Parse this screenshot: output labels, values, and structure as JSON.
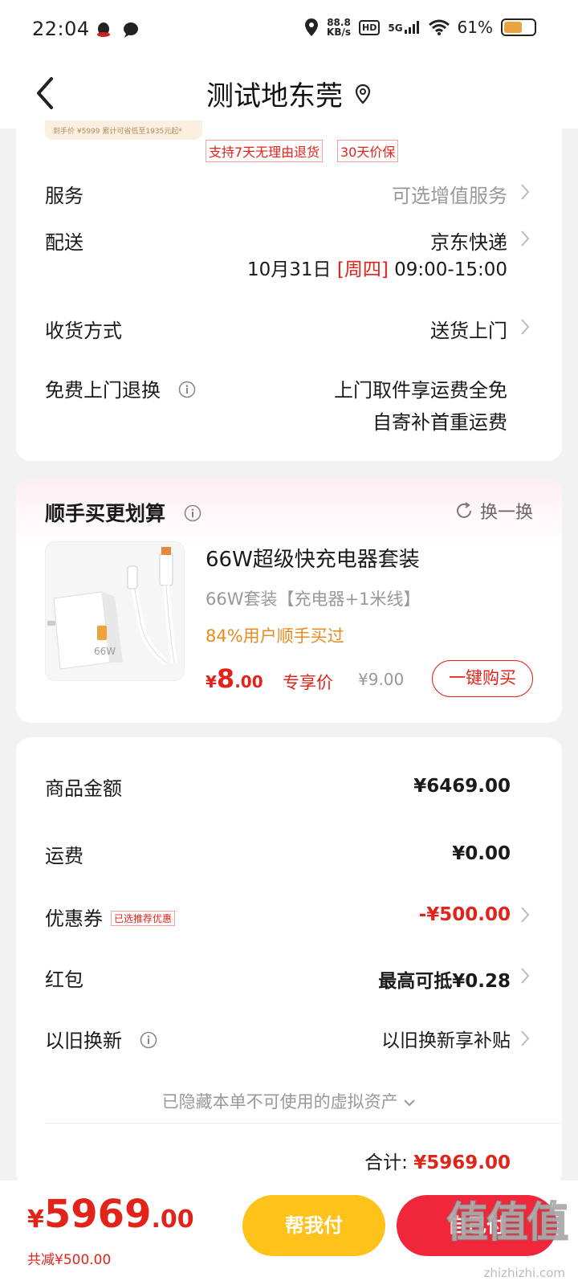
{
  "status_bar": {
    "time": "22:04",
    "speed_value": "88.8",
    "speed_unit": "KB/s",
    "hd": "HD",
    "network": "5G",
    "battery": "61%",
    "battery_level": 0.61
  },
  "header": {
    "title": "测试地东莞"
  },
  "delivery_card": {
    "promo_thumb_text": "到手价 ¥5999    累计可省低至1935元起*",
    "tags": [
      "支持7天无理由退货",
      "30天价保"
    ],
    "service": {
      "label": "服务",
      "value": "可选增值服务"
    },
    "shipping": {
      "label": "配送",
      "value": "京东快递"
    },
    "shipping_date": {
      "date": "10月31日",
      "weekday": "[周四]",
      "time": "09:00-15:00"
    },
    "receive": {
      "label": "收货方式",
      "value": "送货上门"
    },
    "return": {
      "label": "免费上门退换",
      "line1": "上门取件享运费全免",
      "line2": "自寄补首重运费"
    }
  },
  "addon_card": {
    "title": "顺手买更划算",
    "refresh_label": "换一换",
    "product": {
      "name": "66W超级快充电器套装",
      "spec": "66W套装【充电器+1米线】",
      "pct_text": "84%用户顺手买过",
      "price_symbol": "¥",
      "price_int": "8",
      "price_dec": ".00",
      "exclusive_label": "专享价",
      "original_price": "¥9.00",
      "buy_label": "一键购买",
      "image_badge": "66W"
    }
  },
  "summary": {
    "goods": {
      "label": "商品金额",
      "value": "¥6469.00"
    },
    "freight": {
      "label": "运费",
      "value": "¥0.00"
    },
    "coupon": {
      "label": "优惠券",
      "tag": "已选推荐优惠",
      "value": "-¥500.00"
    },
    "red_packet": {
      "label": "红包",
      "value": "最高可抵¥0.28"
    },
    "trade_in": {
      "label": "以旧换新",
      "value": "以旧换新享补贴"
    },
    "hidden_assets": "已隐藏本单不可使用的虚拟资产",
    "total_label": "合计:",
    "total_value": "¥5969.00"
  },
  "bottom": {
    "price_symbol": "¥",
    "price_int": "5969",
    "price_dec": ".00",
    "reduced": "共减¥500.00",
    "help_pay": "帮我付",
    "self_pay": "自己付",
    "watermark": "值值值",
    "watermark_url": "zhizhizhi.com"
  },
  "colors": {
    "accent_red": "#e2231a",
    "help_button": "#ffc21a",
    "pay_button": "#f0263b",
    "orange_text": "#e88b1f"
  },
  "icons": [
    "back-arrow-icon",
    "location-pin-icon",
    "chevron-right-icon",
    "info-icon",
    "refresh-icon",
    "chevron-down-icon"
  ]
}
